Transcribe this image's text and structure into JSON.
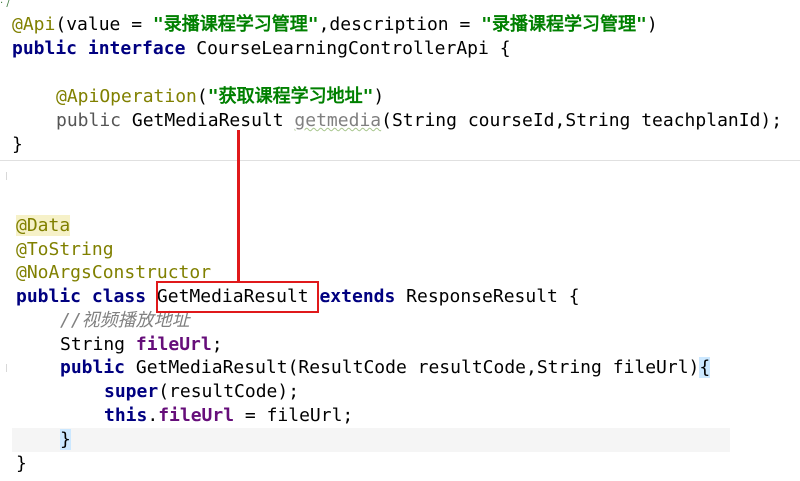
{
  "fragment_top": "· /",
  "code_top": {
    "api_annotation": "@Api",
    "api_value_key": "(value = ",
    "api_value_str": "\"录播课程学习管理\"",
    "api_desc_key": ",description = ",
    "api_desc_str": "\"录播课程学习管理\"",
    "api_close": ")",
    "kw_public": "public",
    "kw_interface": "interface",
    "interface_name": " CourseLearningControllerApi {",
    "op_annotation": "@ApiOperation",
    "op_open": "(",
    "op_str": "\"获取课程学习地址\"",
    "op_close": ")",
    "method_public": "public",
    "method_return": " GetMediaResult ",
    "method_name": "getmedia",
    "method_params": "(String courseId,String teachplanId);",
    "close_brace": "}"
  },
  "code_bottom": {
    "ann_data": "@Data",
    "ann_tostring": "@ToString",
    "ann_noargs": "@NoArgsConstructor",
    "kw_public": "public",
    "kw_class": "class",
    "class_name": "GetMediaResult",
    "kw_extends": "extends",
    "super_class": " ResponseResult {",
    "comment": "//视频播放地址",
    "field_type": "String ",
    "field_name": "fileUrl",
    "field_end": ";",
    "ctor_public": "public",
    "ctor_sig": " GetMediaResult(ResultCode resultCode,String fileUrl)",
    "ctor_open": "{",
    "super_kw": "super",
    "super_args": "(resultCode);",
    "this_kw": "this",
    "this_dot": ".",
    "this_field": "fileUrl",
    "this_assign": " = fileUrl;",
    "ctor_close": "}",
    "class_close": "}"
  },
  "colors": {
    "annotation": "#808000",
    "keyword": "#000080",
    "string": "#008000",
    "field": "#660e7a",
    "comment": "#808080",
    "highlight_box": "#e0191b"
  }
}
